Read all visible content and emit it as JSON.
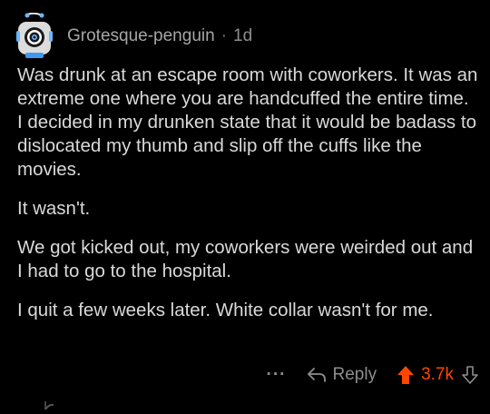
{
  "comment": {
    "username": "Grotesque-penguin",
    "separator": "·",
    "age": "1d",
    "paragraphs": [
      "Was drunk at an escape room with coworkers. It was an extreme one where you are handcuffed the entire time. I decided in my drunken state that it would be badass to dislocated my thumb and slip off the cuffs like the movies.",
      "It wasn't.",
      "We got kicked out, my coworkers were weirded out and I had to go to the hospital.",
      "I quit a few weeks later. White collar wasn't for me."
    ]
  },
  "actions": {
    "more_label": "···",
    "reply_label": "Reply",
    "score": "3.7k",
    "reply_icon": "reply-arrow-icon",
    "upvote_icon": "upvote-arrow-icon",
    "downvote_icon": "downvote-arrow-icon"
  },
  "colors": {
    "background": "#000000",
    "text": "#d9d9d9",
    "muted": "#8e8e8e",
    "upvote_active": "#ff4500"
  }
}
